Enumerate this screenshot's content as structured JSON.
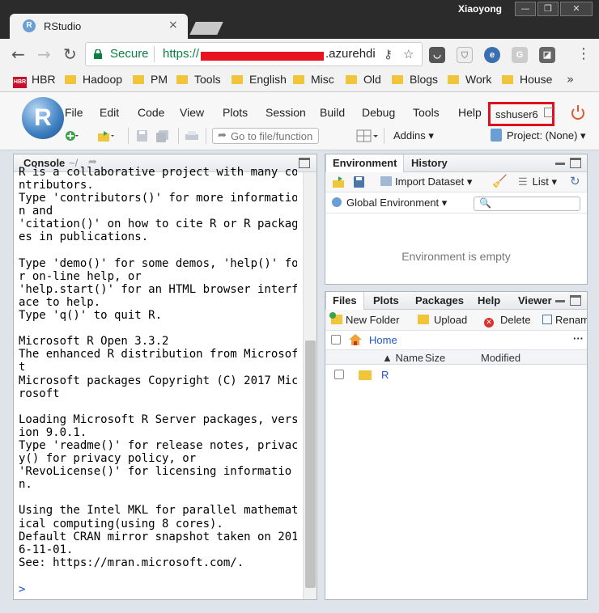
{
  "window": {
    "user": "Xiaoyong",
    "controls": [
      "—",
      "❐",
      "✕"
    ]
  },
  "browser": {
    "tab_title": "RStudio",
    "tab_icon": "R",
    "secure_label": "Secure",
    "url_scheme": "https://",
    "url_domain": ".azurehdi"
  },
  "bookmarks": {
    "hbr_badge": "HBR",
    "items": [
      "HBR",
      "Hadoop",
      "PM",
      "Tools",
      "English",
      "Misc",
      "Old",
      "Blogs",
      "Work",
      "House"
    ],
    "more": "»"
  },
  "rstudio": {
    "logo": "R",
    "menus": [
      "File",
      "Edit",
      "Code",
      "View",
      "Plots",
      "Session",
      "Build",
      "Debug",
      "Tools",
      "Help"
    ],
    "user": "sshuser6",
    "goto_placeholder": "Go to file/function",
    "addins": "Addins ▾",
    "project": "Project: (None) ▾"
  },
  "console": {
    "tab": "Console",
    "path": "~/",
    "text": "R is a collaborative project with many co\nntributors.\nType 'contributors()' for more informatio\nn and\n'citation()' on how to cite R or R packag\nes in publications.\n\nType 'demo()' for some demos, 'help()' fo\nr on-line help, or\n'help.start()' for an HTML browser interf\nace to help.\nType 'q()' to quit R.\n\nMicrosoft R Open 3.3.2\nThe enhanced R distribution from Microsof\nt\nMicrosoft packages Copyright (C) 2017 Mic\nrosoft\n\nLoading Microsoft R Server packages, vers\nion 9.0.1.\nType 'readme()' for release notes, privac\ny() for privacy policy, or\n'RevoLicense()' for licensing informatio\nn.\n\nUsing the Intel MKL for parallel mathemat\nical computing(using 8 cores).\nDefault CRAN mirror snapshot taken on 201\n6-11-01.\nSee: https://mran.microsoft.com/.",
    "prompt": ">"
  },
  "environment": {
    "tabs": [
      "Environment",
      "History"
    ],
    "import_label": "Import Dataset ▾",
    "list_label": "List ▾",
    "scope": "Global Environment ▾",
    "empty": "Environment is empty"
  },
  "files": {
    "tabs": [
      "Files",
      "Plots",
      "Packages",
      "Help",
      "Viewer"
    ],
    "new_folder": "New Folder",
    "upload": "Upload",
    "delete": "Delete",
    "rename": "Rename",
    "home": "Home",
    "more": "···",
    "columns": {
      "name": "▲ Name",
      "size": "Size",
      "modified": "Modified"
    },
    "rows": [
      {
        "name": "R",
        "size": "",
        "modified": ""
      }
    ]
  }
}
